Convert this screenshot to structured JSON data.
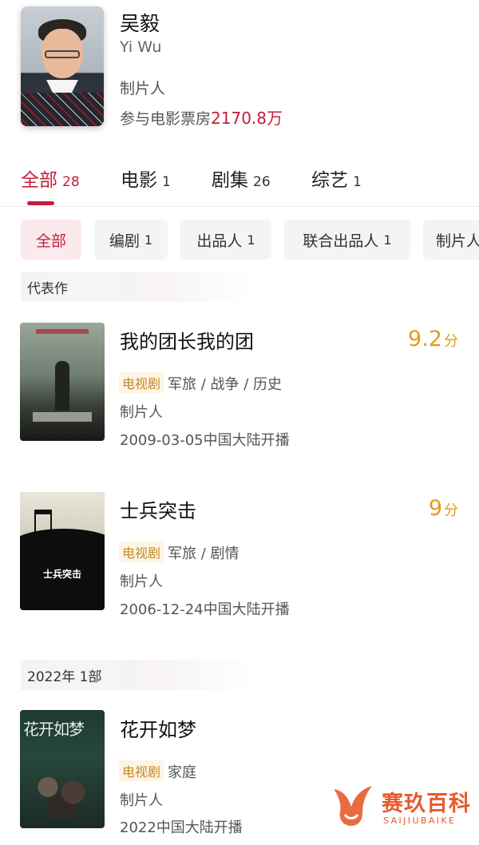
{
  "profile": {
    "name": "吴毅",
    "name_en": "Yi Wu",
    "role": "制片人",
    "boxoffice_label": "参与电影票房",
    "boxoffice_value": "2170.8万"
  },
  "tabs": [
    {
      "label": "全部",
      "count": "28",
      "active": true
    },
    {
      "label": "电影",
      "count": "1"
    },
    {
      "label": "剧集",
      "count": "26"
    },
    {
      "label": "综艺",
      "count": "1"
    }
  ],
  "filters": [
    {
      "label": "全部",
      "count": "",
      "active": true
    },
    {
      "label": "编剧",
      "count": "1"
    },
    {
      "label": "出品人",
      "count": "1"
    },
    {
      "label": "联合出品人",
      "count": "1"
    },
    {
      "label": "制片人",
      "count": ""
    }
  ],
  "sections": {
    "representative": "代表作",
    "year_2022": "2022年 1部"
  },
  "works": [
    {
      "title": "我的团长我的团",
      "score": "9.2",
      "score_unit": "分",
      "tag": "电视剧",
      "genres": "军旅 / 战争 / 历史",
      "role": "制片人",
      "date": "2009-03-05中国大陆开播"
    },
    {
      "title": "士兵突击",
      "score": "9",
      "score_unit": "分",
      "tag": "电视剧",
      "genres": "军旅 / 剧情",
      "role": "制片人",
      "date": "2006-12-24中国大陆开播",
      "poster_text": "士兵突击"
    },
    {
      "title": "花开如梦",
      "tag": "电视剧",
      "genres": "家庭",
      "role": "制片人",
      "date": "2022中国大陆开播",
      "poster_text": "花开如梦"
    }
  ],
  "watermark": {
    "text": "赛玖百科",
    "sub": "SAIJIUBAIKE"
  },
  "colors": {
    "accent": "#c2203a",
    "score": "#e39a1b",
    "tag_bg": "#fdf4e3",
    "tag_text": "#c38a2a",
    "watermark": "#e85b2c"
  }
}
